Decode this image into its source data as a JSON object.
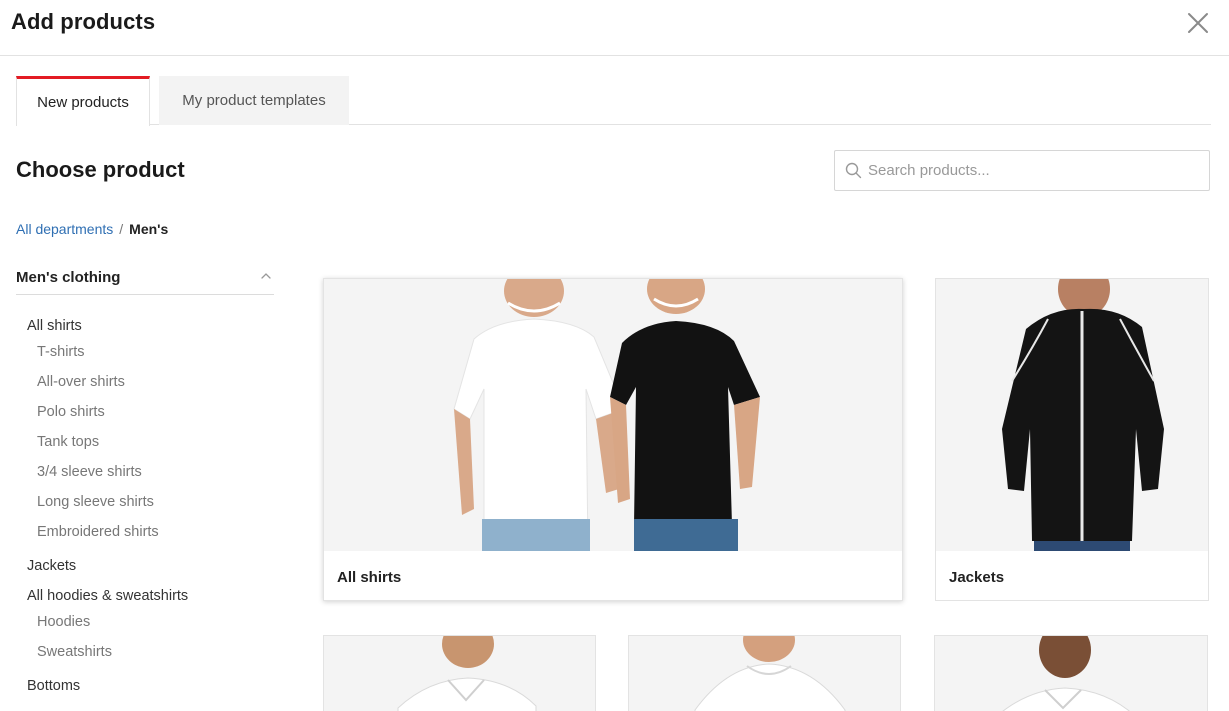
{
  "header": {
    "title": "Add products",
    "close_icon": "close-icon"
  },
  "tabs": [
    {
      "label": "New products",
      "active": true
    },
    {
      "label": "My product templates",
      "active": false
    }
  ],
  "main": {
    "heading": "Choose product",
    "search": {
      "placeholder": "Search products...",
      "value": ""
    }
  },
  "breadcrumb": {
    "root": "All departments",
    "separator": "/",
    "current": "Men's"
  },
  "sidebar": {
    "section": "Men's clothing",
    "items": [
      {
        "label": "All shirts",
        "level": "category"
      },
      {
        "label": "T-shirts",
        "level": "sub"
      },
      {
        "label": "All-over shirts",
        "level": "sub"
      },
      {
        "label": "Polo shirts",
        "level": "sub"
      },
      {
        "label": "Tank tops",
        "level": "sub"
      },
      {
        "label": "3/4 sleeve shirts",
        "level": "sub"
      },
      {
        "label": "Long sleeve shirts",
        "level": "sub"
      },
      {
        "label": "Embroidered shirts",
        "level": "sub"
      },
      {
        "label": "Jackets",
        "level": "category"
      },
      {
        "label": "All hoodies & sweatshirts",
        "level": "category"
      },
      {
        "label": "Hoodies",
        "level": "sub"
      },
      {
        "label": "Sweatshirts",
        "level": "sub"
      },
      {
        "label": "Bottoms",
        "level": "category"
      }
    ]
  },
  "products": [
    {
      "label": "All shirts"
    },
    {
      "label": "Jackets"
    },
    {
      "label": ""
    },
    {
      "label": ""
    },
    {
      "label": ""
    }
  ],
  "colors": {
    "accent": "#e31b23",
    "link": "#2f6fb3"
  }
}
